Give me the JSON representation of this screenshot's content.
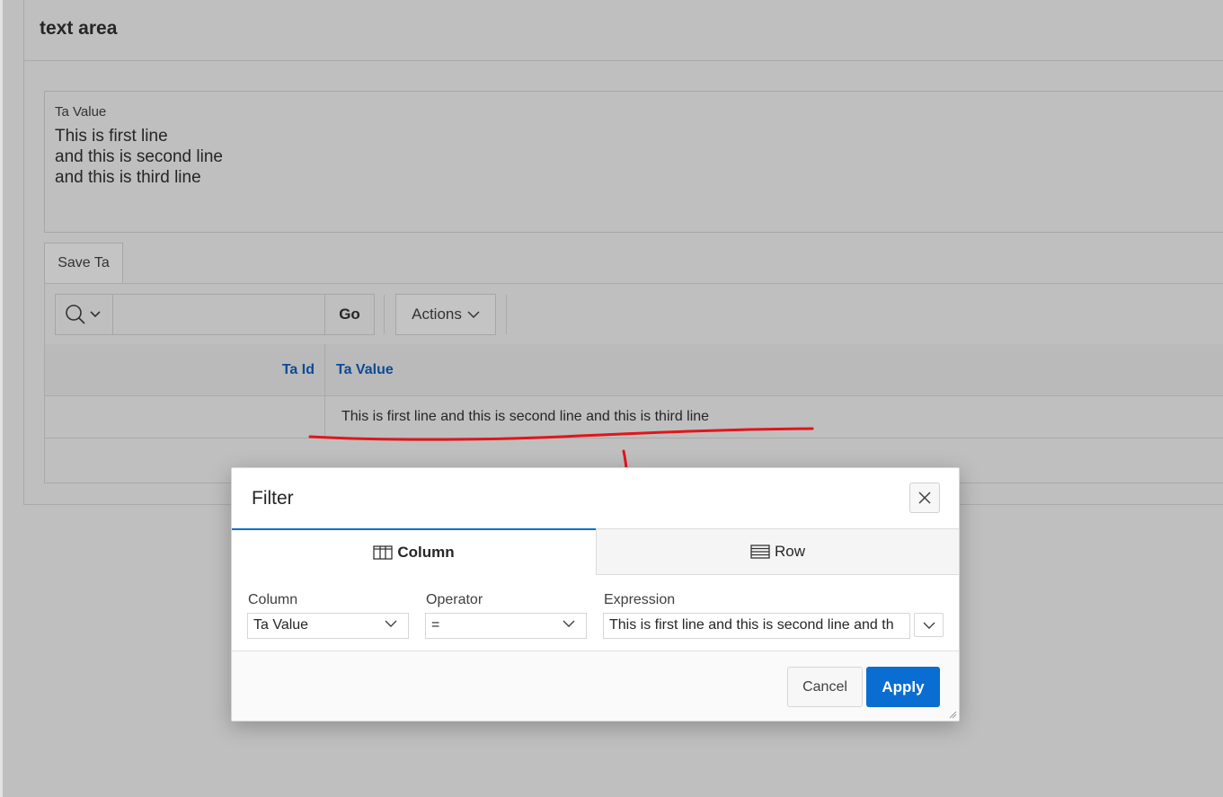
{
  "region": {
    "title": "text area"
  },
  "textarea": {
    "label": "Ta Value",
    "lines": [
      "This is first line",
      "and this is second line",
      "and this is third line"
    ]
  },
  "buttons": {
    "save": "Save Ta"
  },
  "report": {
    "toolbar": {
      "go_label": "Go",
      "actions_label": "Actions",
      "search_value": ""
    },
    "columns": [
      "Ta Id",
      "Ta Value"
    ],
    "rows": [
      {
        "ta_id": "",
        "ta_value": "This is first line and this is second line and this is third line"
      }
    ]
  },
  "dialog": {
    "title": "Filter",
    "tabs": {
      "column": "Column",
      "row": "Row",
      "active": "Column"
    },
    "fields": {
      "column_label": "Column",
      "column_value": "Ta Value",
      "operator_label": "Operator",
      "operator_value": "=",
      "expression_label": "Expression",
      "expression_value": "This is first line and this is second line and th"
    },
    "buttons": {
      "cancel": "Cancel",
      "apply": "Apply"
    }
  },
  "colors": {
    "accent": "#0a6dd1",
    "header_link": "#0b4a96",
    "annotation": "#e0161c",
    "overlay_bg": "#bfbfbf"
  },
  "icons": [
    "search-icon",
    "chevron-down-icon",
    "close-icon",
    "table-column-icon",
    "table-row-icon",
    "resize-icon"
  ]
}
